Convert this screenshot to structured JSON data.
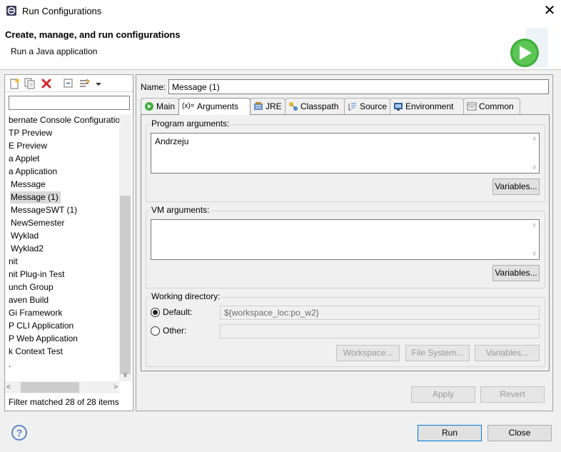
{
  "window": {
    "title": "Run Configurations",
    "close_glyph": "✕"
  },
  "banner": {
    "heading": "Create, manage, and run configurations",
    "subtitle": "Run a Java application"
  },
  "toolbar": {
    "buttons": [
      "new-configuration-icon",
      "duplicate-icon",
      "delete-icon",
      "collapse-all-icon",
      "filter-icon",
      "view-menu-icon"
    ]
  },
  "filter": {
    "value": "",
    "status": "Filter matched 28 of 28 items"
  },
  "tree": {
    "items": [
      {
        "label": "bernate Console Configuratio"
      },
      {
        "label": "TP Preview"
      },
      {
        "label": "E Preview"
      },
      {
        "label": "a Applet"
      },
      {
        "label": "a Application"
      },
      {
        "label": "Message"
      },
      {
        "label": "Message (1)",
        "selected": true
      },
      {
        "label": "MessageSWT (1)"
      },
      {
        "label": "NewSemester"
      },
      {
        "label": "Wyklad"
      },
      {
        "label": "Wyklad2"
      },
      {
        "label": "nit"
      },
      {
        "label": "nit Plug-in Test"
      },
      {
        "label": "unch Group"
      },
      {
        "label": "aven Build"
      },
      {
        "label": "Gi Framework"
      },
      {
        "label": "P CLI Application"
      },
      {
        "label": "P Web Application"
      },
      {
        "label": "k Context Test"
      },
      {
        "label": "."
      }
    ]
  },
  "config": {
    "name_label": "Name:",
    "name_value": "Message (1)",
    "tabs": [
      {
        "label": "Main",
        "icon": "main-tab-icon"
      },
      {
        "label": "Arguments",
        "icon": "arguments-tab-icon",
        "active": true
      },
      {
        "label": "JRE",
        "icon": "jre-tab-icon"
      },
      {
        "label": "Classpath",
        "icon": "classpath-tab-icon"
      },
      {
        "label": "Source",
        "icon": "source-tab-icon"
      },
      {
        "label": "Environment",
        "icon": "environment-tab-icon"
      },
      {
        "label": "Common",
        "icon": "common-tab-icon"
      }
    ],
    "arguments_tab_glyph": "(x)=",
    "program_args": {
      "label": "Program arguments:",
      "value": "Andrzeju",
      "variables_button": "Variables..."
    },
    "vm_args": {
      "label": "VM arguments:",
      "value": "",
      "variables_button": "Variables..."
    },
    "working_dir": {
      "label": "Working directory:",
      "default_label": "Default:",
      "default_value": "${workspace_loc:po_w2}",
      "other_label": "Other:",
      "other_value": "",
      "selected": "default",
      "workspace_button": "Workspace...",
      "filesystem_button": "File System...",
      "variables_button": "Variables..."
    },
    "apply_button": "Apply",
    "revert_button": "Revert"
  },
  "footer": {
    "help_glyph": "?",
    "run_button": "Run",
    "close_button": "Close"
  },
  "colors": {
    "accent": "#0078d7",
    "run_icon_green": "#3fae3a",
    "delete_red": "#d9262b"
  }
}
